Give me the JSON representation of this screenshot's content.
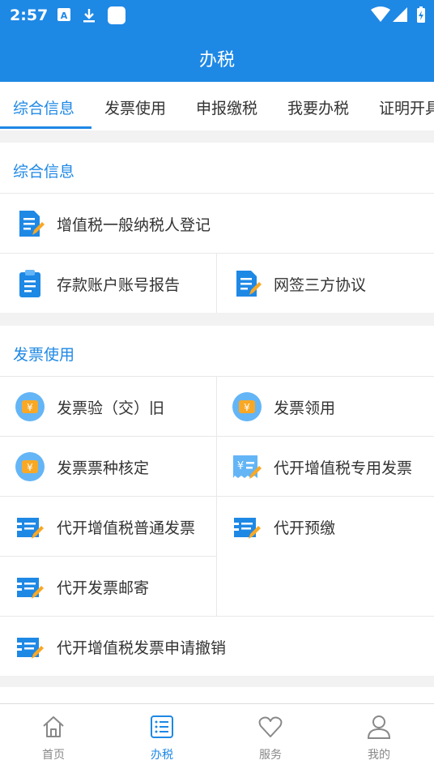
{
  "status_bar": {
    "time": "2:57"
  },
  "header": {
    "title": "办税"
  },
  "tabs": [
    "综合信息",
    "发票使用",
    "申报缴税",
    "我要办税",
    "证明开具"
  ],
  "sections": {
    "info": {
      "title": "综合信息",
      "items": [
        "增值税一般纳税人登记",
        "存款账户账号报告",
        "网签三方协议"
      ]
    },
    "invoice": {
      "title": "发票使用",
      "items": [
        "发票验（交）旧",
        "发票领用",
        "发票票种核定",
        "代开增值税专用发票",
        "代开增值税普通发票",
        "代开预缴",
        "代开发票邮寄",
        "代开增值税发票申请撤销"
      ]
    }
  },
  "bottom_nav": [
    "首页",
    "办税",
    "服务",
    "我的"
  ],
  "colors": {
    "primary": "#1e88e5",
    "icon_light": "#64b5f6",
    "coin": "#f9a825"
  }
}
